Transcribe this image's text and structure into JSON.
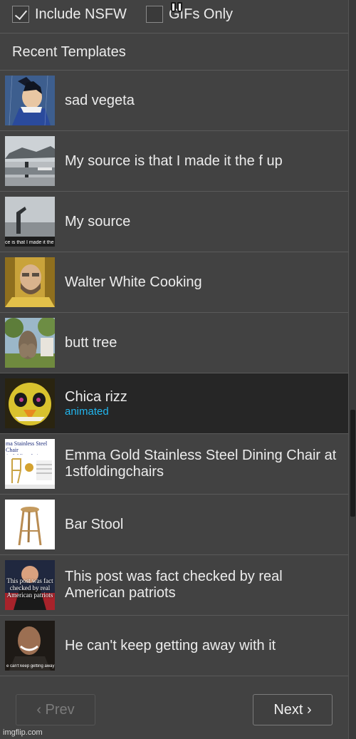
{
  "filters": {
    "nsfw_label": "Include NSFW",
    "nsfw_checked": true,
    "gifs_label": "GIFs Only",
    "gifs_checked": false
  },
  "section_title": "Recent Templates",
  "templates": [
    {
      "name": "sad vegeta",
      "thumb": "vegeta-thumbnail"
    },
    {
      "name": "My source is that I made it the f up",
      "thumb": "monument-source-thumbnail"
    },
    {
      "name": "My source",
      "thumb": "monument-thumbnail",
      "thumb_caption": "ce is that I made it the"
    },
    {
      "name": "Walter White Cooking",
      "thumb": "walter-white-thumbnail"
    },
    {
      "name": "butt tree",
      "thumb": "tree-thumbnail"
    },
    {
      "name": "Chica rizz",
      "sub": "animated",
      "thumb": "chica-thumbnail",
      "active": true
    },
    {
      "name": "Emma Gold Stainless Steel Dining Chair at 1stfoldingchairs",
      "thumb": "chair-ad-thumbnail",
      "thumb_caption": "ma Stainless Steel Chair 1stfoldingchairs.com"
    },
    {
      "name": "Bar Stool",
      "thumb": "bar-stool-thumbnail"
    },
    {
      "name": "This post was fact checked by real American patriots",
      "thumb": "fact-check-thumbnail",
      "thumb_caption": "This post was fact checked by real American patriots"
    },
    {
      "name": "He can't keep getting away with it",
      "thumb": "getting-away-thumbnail",
      "thumb_caption": "e can't keep getting away with it"
    }
  ],
  "pager": {
    "prev_label": "‹ Prev",
    "next_label": "Next ›"
  },
  "watermark": "imgflip.com",
  "colors": {
    "panel_bg": "#424242",
    "active_row_bg": "#262626",
    "sub_label": "#21b6ee",
    "text": "#ececec"
  }
}
